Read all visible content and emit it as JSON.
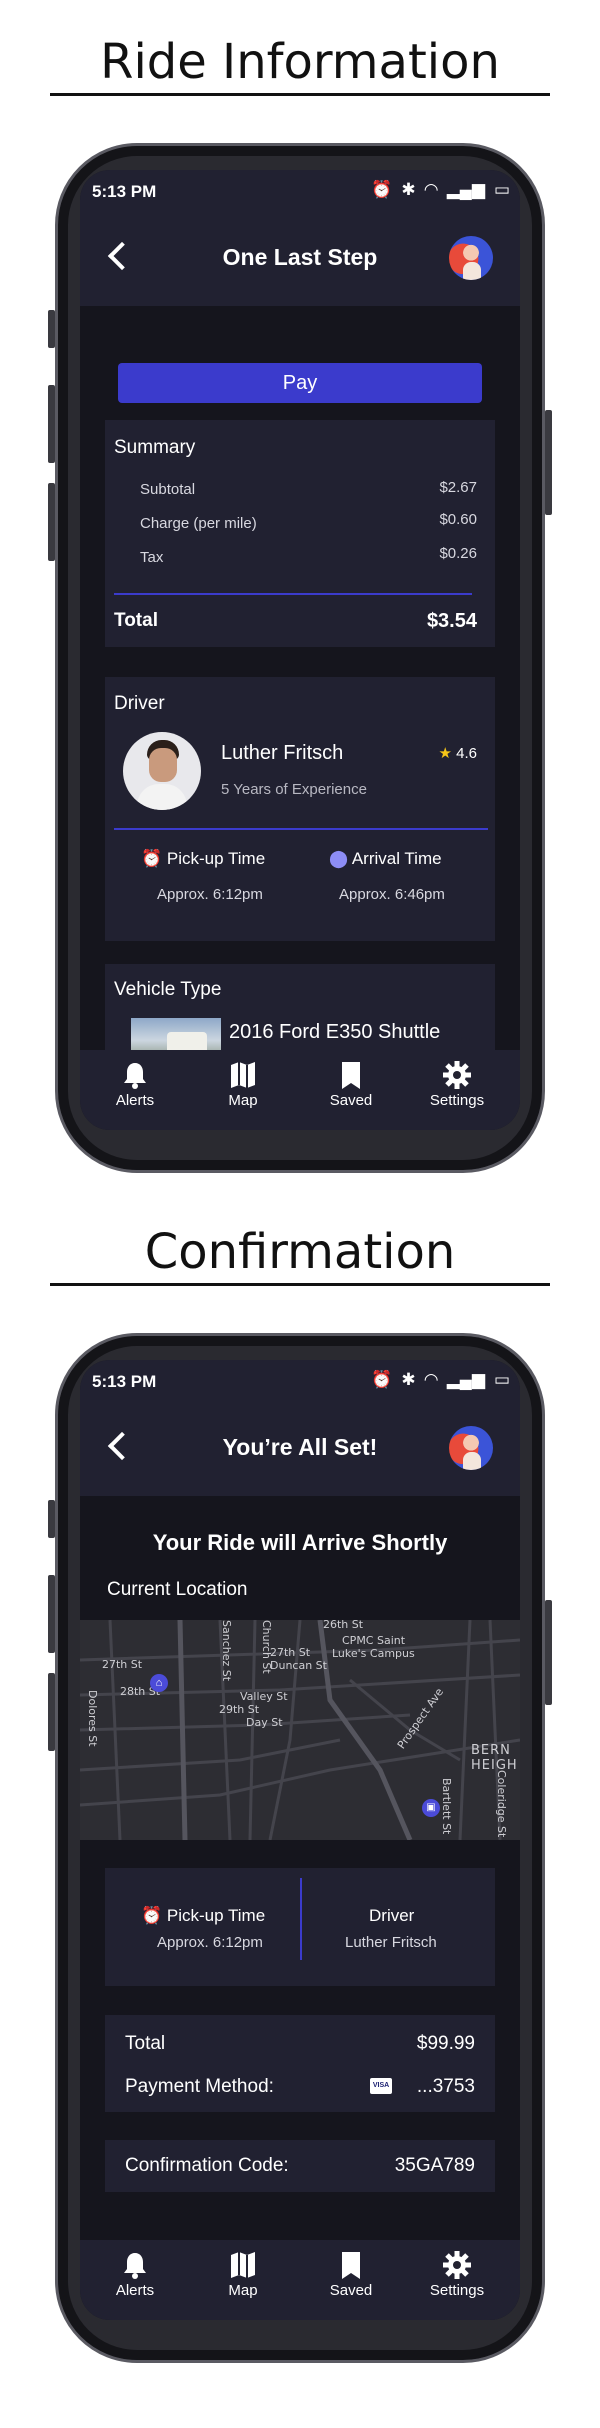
{
  "screens": [
    {
      "section_title": "Ride Information",
      "status": {
        "time": "5:13 PM"
      },
      "header": {
        "title": "One Last Step"
      },
      "pay_button": "Pay",
      "summary": {
        "title": "Summary",
        "rows": [
          {
            "label": "Subtotal",
            "value": "$2.67"
          },
          {
            "label": "Charge (per mile)",
            "value": "$0.60"
          },
          {
            "label": "Tax",
            "value": "$0.26"
          }
        ],
        "total_label": "Total",
        "total_value": "$3.54"
      },
      "driver": {
        "title": "Driver",
        "name": "Luther Fritsch",
        "rating": "4.6",
        "experience": "5 Years of Experience",
        "pickup_label": "Pick-up Time",
        "pickup_value": "Approx. 6:12pm",
        "arrival_label": "Arrival Time",
        "arrival_value": "Approx. 6:46pm"
      },
      "vehicle": {
        "title": "Vehicle Type",
        "name": "2016 Ford E350 Shuttle"
      },
      "nav": [
        "Alerts",
        "Map",
        "Saved",
        "Settings"
      ]
    },
    {
      "section_title": "Confirmation",
      "status": {
        "time": "5:13 PM"
      },
      "header": {
        "title": "You’re All Set!"
      },
      "headline": "Your Ride will Arrive Shortly",
      "location_label": "Current Location",
      "map_labels": [
        "26th St",
        "CPMC Saint",
        "Luke's Campus",
        "27th St",
        "27th St",
        "Duncan St",
        "28th St",
        "Valley St",
        "29th St",
        "Day St",
        "Dolores St",
        "Sanchez St",
        "Church St",
        "Prospect Ave",
        "BERN",
        "HEIGH",
        "Bartlett St",
        "Coleridge St"
      ],
      "pickup_label": "Pick-up Time",
      "pickup_value": "Approx. 6:12pm",
      "driver_label": "Driver",
      "driver_value": "Luther Fritsch",
      "total_label": "Total",
      "total_value": "$99.99",
      "payment_label": "Payment Method:",
      "payment_card": "VISA",
      "payment_value": "...3753",
      "confirmation_label": "Confirmation Code:",
      "confirmation_value": "35GA789",
      "nav": [
        "Alerts",
        "Map",
        "Saved",
        "Settings"
      ]
    }
  ],
  "colors": {
    "accent": "#3b3bcc",
    "panel": "#212131",
    "screen": "#15151d",
    "star": "#f5c518"
  },
  "icons": [
    "alarm-icon",
    "bluetooth-icon",
    "wifi-icon",
    "signal-icon",
    "battery-icon",
    "bell-icon",
    "map-icon",
    "bookmark-icon",
    "gear-icon",
    "clock-icon",
    "location-pin-icon",
    "star-icon",
    "home-marker-icon",
    "bus-marker-icon",
    "visa-icon"
  ]
}
